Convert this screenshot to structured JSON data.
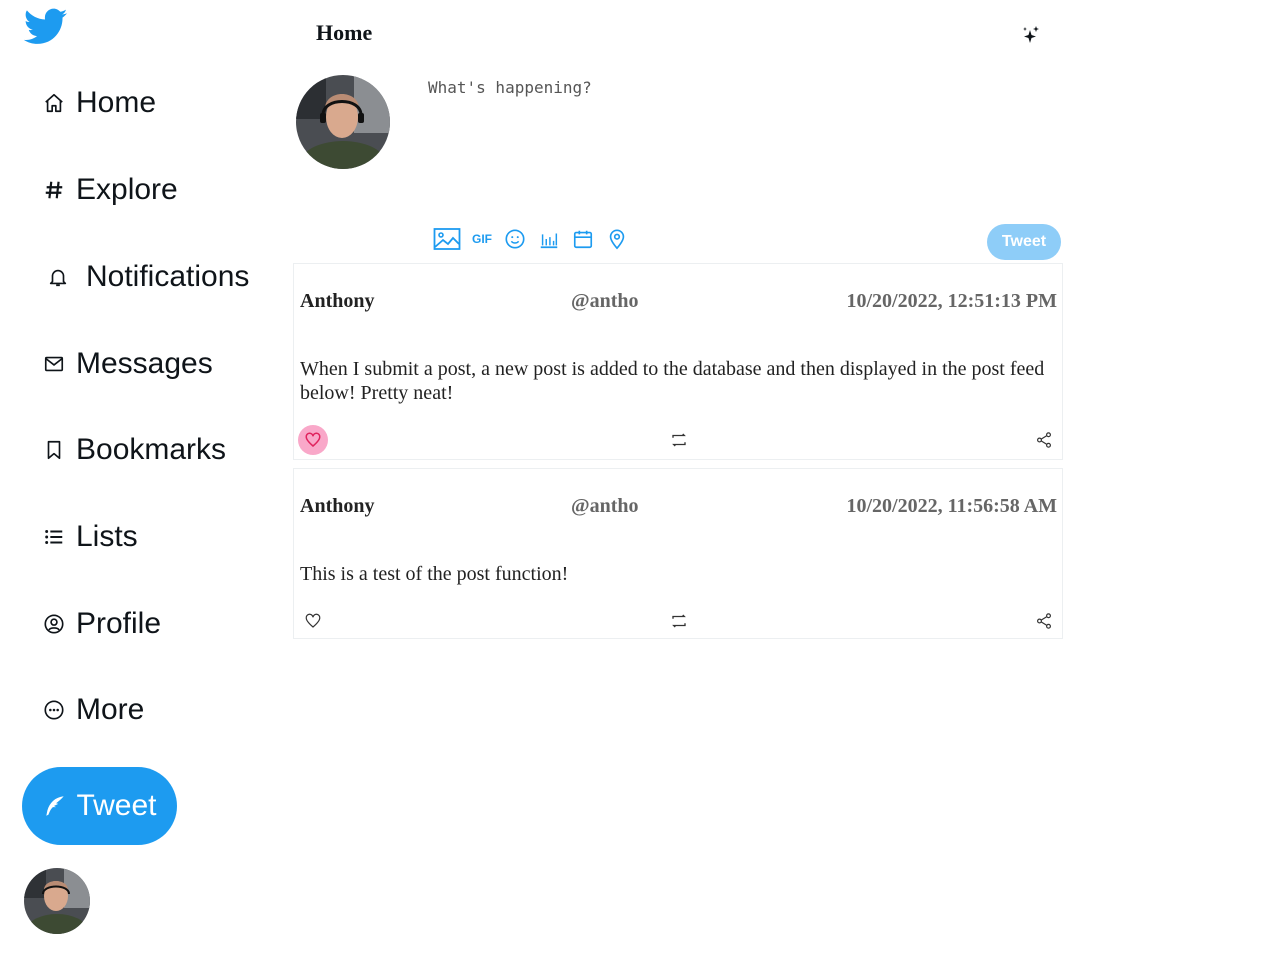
{
  "sidebar": {
    "logo_icon": "twitter-bird-icon",
    "items": [
      {
        "label": "Home",
        "icon": "home-icon"
      },
      {
        "label": "Explore",
        "icon": "hash-icon"
      },
      {
        "label": "Notifications",
        "icon": "bell-icon"
      },
      {
        "label": "Messages",
        "icon": "mail-icon"
      },
      {
        "label": "Bookmarks",
        "icon": "bookmark-icon"
      },
      {
        "label": "Lists",
        "icon": "list-icon"
      },
      {
        "label": "Profile",
        "icon": "user-circle-icon"
      },
      {
        "label": "More",
        "icon": "more-circle-icon"
      }
    ],
    "tweet_button_label": "Tweet"
  },
  "header": {
    "title": "Home",
    "sparkle_icon": "sparkle-icon"
  },
  "composer": {
    "placeholder": "What's happening?",
    "value": "",
    "tools": [
      "image-icon",
      "gif-icon",
      "emoji-icon",
      "poll-icon",
      "schedule-icon",
      "location-icon"
    ],
    "gif_label": "GIF",
    "tweet_button_label": "Tweet"
  },
  "posts": [
    {
      "name": "Anthony",
      "handle": "@antho",
      "time": "10/20/2022, 12:51:13 PM",
      "body": "When I submit a post, a new post is added to the database and then displayed in the post feed below! Pretty neat!",
      "liked": true
    },
    {
      "name": "Anthony",
      "handle": "@antho",
      "time": "10/20/2022, 11:56:58 AM",
      "body": "This is a test of the post function!",
      "liked": false
    }
  ],
  "colors": {
    "accent": "#1d9bf0",
    "accent_disabled": "#8ecdf8",
    "like_active_bg": "#f9a8c9",
    "like_active": "#e0245e"
  }
}
